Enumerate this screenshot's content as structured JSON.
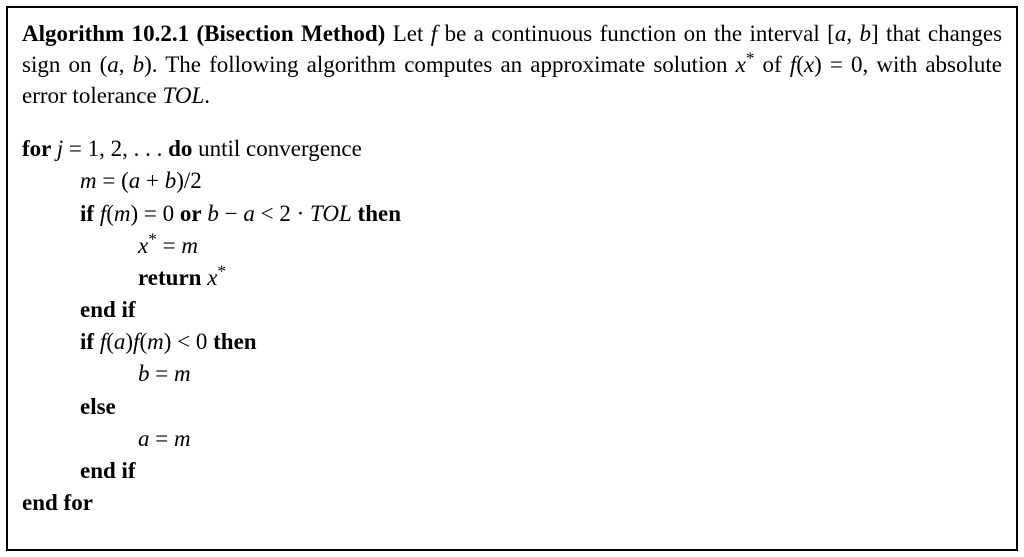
{
  "algo_number": "Algorithm 10.2.1",
  "algo_title": "(Bisection Method)",
  "intro_part1": "Let ",
  "intro_f": "f",
  "intro_part2": " be a continuous function on the interval [",
  "intro_a": "a",
  "intro_comma1": ", ",
  "intro_b": "b",
  "intro_part3": "] that changes sign on (",
  "intro_a2": "a",
  "intro_comma2": ", ",
  "intro_b2": "b",
  "intro_part4": "). The following algorithm computes an approximate solution ",
  "intro_x": "x",
  "intro_star": "*",
  "intro_part5": " of ",
  "intro_fx": "f",
  "intro_lp": "(",
  "intro_xvar": "x",
  "intro_rp": ")",
  "intro_eq0": " = 0, with absolute error tolerance ",
  "intro_tol": "TOL",
  "intro_period": ".",
  "kw_for": "for ",
  "loop_j": "j",
  "loop_eq": " = 1, 2, . . . ",
  "kw_do": "do",
  "loop_until": " until convergence",
  "m_var": "m",
  "m_eq": " = (",
  "m_a": "a",
  "m_plus": " + ",
  "m_b": "b",
  "m_close": ")/2",
  "kw_if1": "if ",
  "if1_f": "f",
  "if1_lp": "(",
  "if1_m": "m",
  "if1_rp": ")",
  "if1_eq0": " = 0 ",
  "kw_or": "or",
  "if1_sp": " ",
  "if1_b": "b",
  "if1_minus": " − ",
  "if1_a": "a",
  "if1_lt": " < 2 · ",
  "if1_tol": "TOL",
  "if1_sp2": " ",
  "kw_then1": "then",
  "xstar_x": "x",
  "xstar_star": "*",
  "xstar_eq": " = ",
  "xstar_m": "m",
  "kw_return": "return ",
  "ret_x": "x",
  "ret_star": "*",
  "kw_endif1": "end if",
  "kw_if2": "if ",
  "if2_f1": "f",
  "if2_lp1": "(",
  "if2_a": "a",
  "if2_rp1": ")",
  "if2_f2": "f",
  "if2_lp2": "(",
  "if2_m": "m",
  "if2_rp2": ")",
  "if2_lt0": " < 0 ",
  "kw_then2": "then",
  "bm_b": "b",
  "bm_eq": " = ",
  "bm_m": "m",
  "kw_else": "else",
  "am_a": "a",
  "am_eq": " = ",
  "am_m": "m",
  "kw_endif2": "end if",
  "kw_endfor": "end for"
}
